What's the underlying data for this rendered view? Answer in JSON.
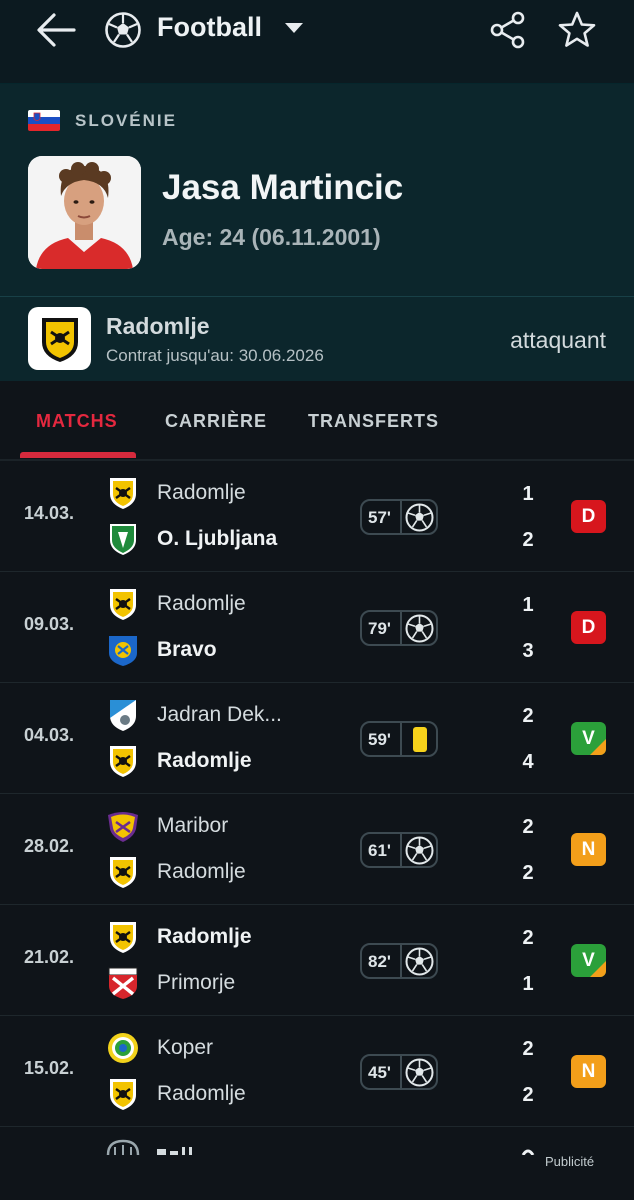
{
  "header": {
    "sport": "Football",
    "icons": [
      "back-arrow-icon",
      "football-icon",
      "chevron-down-icon",
      "share-icon",
      "star-icon"
    ]
  },
  "player": {
    "country": "SLOVÉNIE",
    "name": "Jasa Martincic",
    "age": "Age: 24 (06.11.2001)",
    "club": "Radomlje",
    "contract": "Contrat jusqu'au: 30.06.2026",
    "position": "attaquant"
  },
  "tabs": [
    "MATCHS",
    "CARRIÈRE",
    "TRANSFERTS"
  ],
  "active_tab": "MATCHS",
  "colors": {
    "accent_red": "#d72a3d",
    "loss": "#d7161d",
    "win": "#2ba03a",
    "draw": "#f39f1a"
  },
  "matches": [
    {
      "date": "14.03.",
      "home": "Radomlje",
      "away": "O. Ljubljana",
      "bold": "away",
      "home_logo": "radomlje",
      "away_logo": "olimpija",
      "minute": "57'",
      "event": "ball",
      "home_score": "1",
      "away_score": "2",
      "result": "D",
      "result_type": "loss"
    },
    {
      "date": "09.03.",
      "home": "Radomlje",
      "away": "Bravo",
      "bold": "away",
      "home_logo": "radomlje",
      "away_logo": "bravo",
      "minute": "79'",
      "event": "ball",
      "home_score": "1",
      "away_score": "3",
      "result": "D",
      "result_type": "loss"
    },
    {
      "date": "04.03.",
      "home": "Jadran Dek...",
      "away": "Radomlje",
      "bold": "away",
      "home_logo": "jadran",
      "away_logo": "radomlje",
      "minute": "59'",
      "event": "yellow-card",
      "home_score": "2",
      "away_score": "4",
      "result": "V",
      "result_type": "win"
    },
    {
      "date": "28.02.",
      "home": "Maribor",
      "away": "Radomlje",
      "bold": "none",
      "home_logo": "maribor",
      "away_logo": "radomlje",
      "minute": "61'",
      "event": "ball",
      "home_score": "2",
      "away_score": "2",
      "result": "N",
      "result_type": "draw"
    },
    {
      "date": "21.02.",
      "home": "Radomlje",
      "away": "Primorje",
      "bold": "home",
      "home_logo": "radomlje",
      "away_logo": "primorje",
      "minute": "82'",
      "event": "ball",
      "home_score": "2",
      "away_score": "1",
      "result": "V",
      "result_type": "win"
    },
    {
      "date": "15.02.",
      "home": "Koper",
      "away": "Radomlje",
      "bold": "none",
      "home_logo": "koper",
      "away_logo": "radomlje",
      "minute": "45'",
      "event": "ball",
      "home_score": "2",
      "away_score": "2",
      "result": "N",
      "result_type": "draw"
    }
  ],
  "ad_label": "Publicité"
}
